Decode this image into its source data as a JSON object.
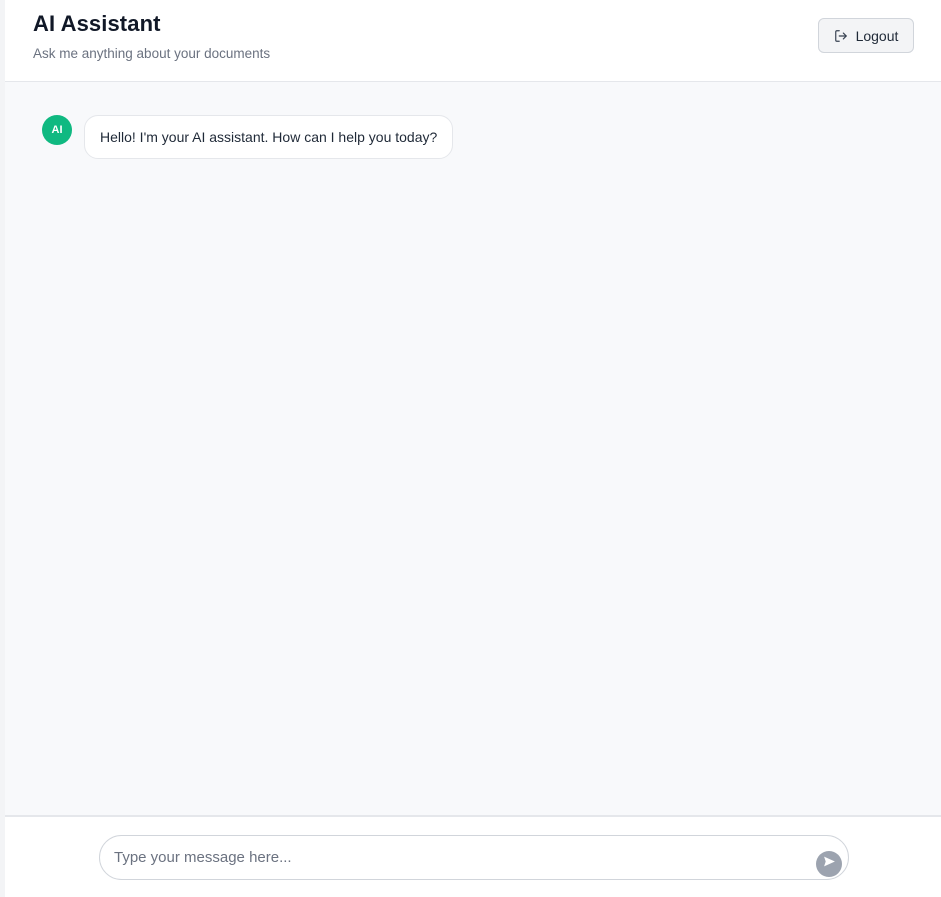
{
  "header": {
    "title": "AI Assistant",
    "subtitle": "Ask me anything about your documents",
    "logout_label": "Logout",
    "logout_icon": "logout-icon"
  },
  "messages": [
    {
      "sender": "assistant",
      "avatar_label": "AI",
      "text": "Hello! I'm your AI assistant. How can I help you today?"
    }
  ],
  "composer": {
    "value": "",
    "placeholder": "Type your message here...",
    "send_icon": "send-icon"
  },
  "colors": {
    "avatar_bg": "#10b981",
    "send_button_bg": "#9ca3af",
    "chat_bg": "#f8f9fb"
  }
}
